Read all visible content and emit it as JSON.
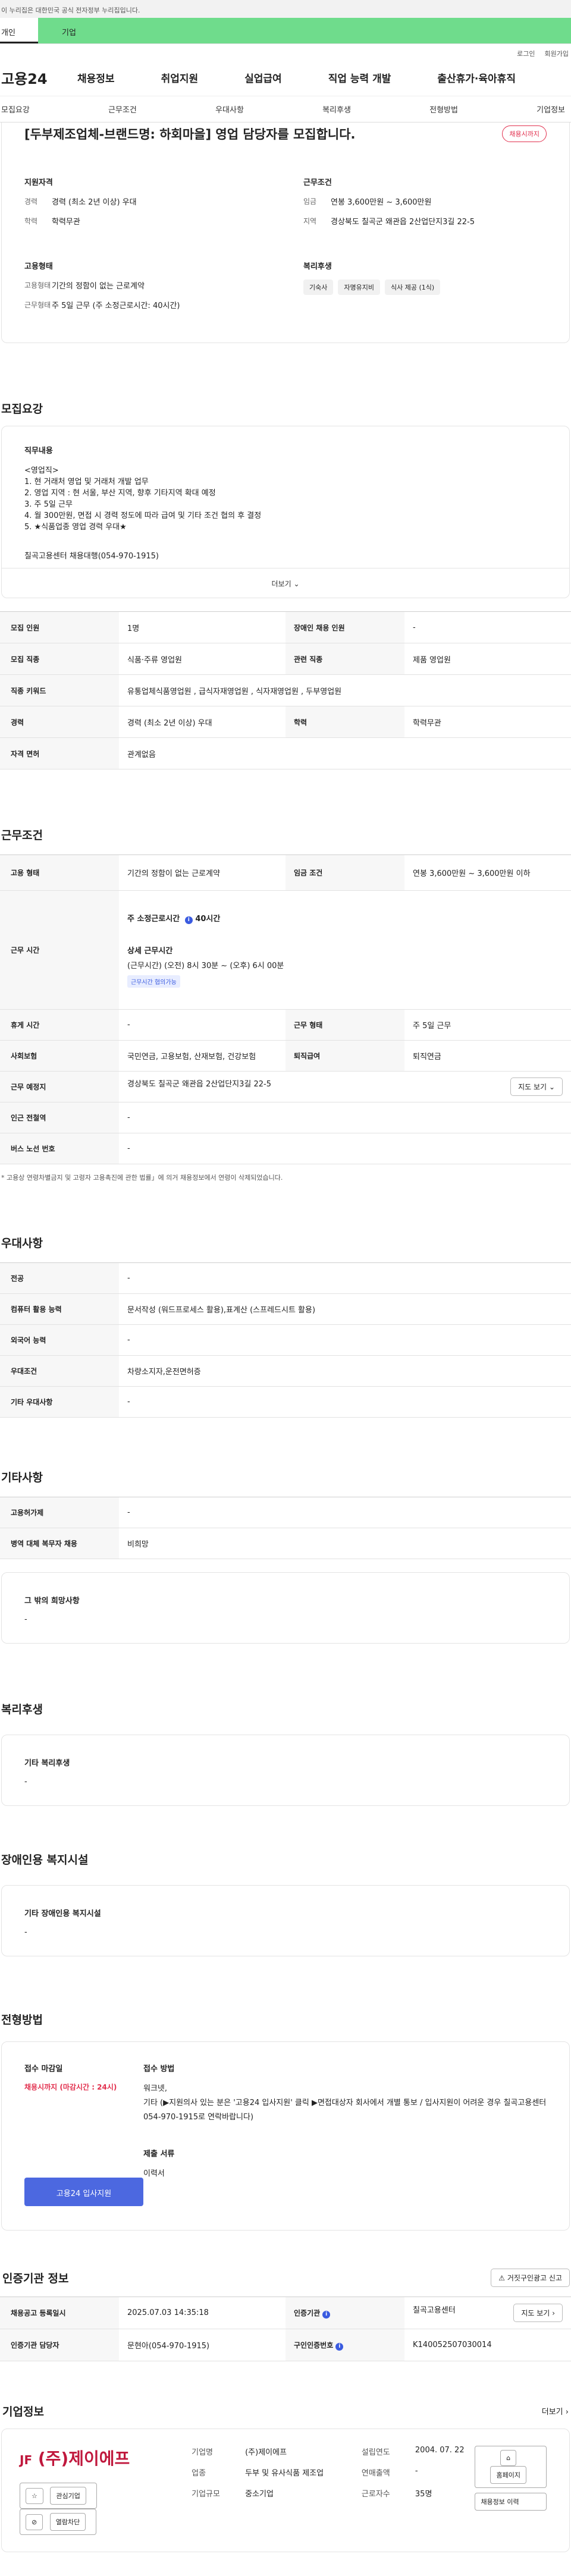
{
  "gov_banner": "이 누리집은 대한민국 공식 전자정부 누리집입니다.",
  "user_tabs": [
    "개인",
    "기업"
  ],
  "login_links": [
    "로그인",
    "회원가입"
  ],
  "logo": "고용24",
  "gnb": [
    "채용정보",
    "취업지원",
    "실업급여",
    "직업 능력 개발",
    "출산휴가·육아휴직"
  ],
  "subnav": [
    "모집요강",
    "근무조건",
    "우대사항",
    "복리후생",
    "전형방법",
    "기업정보"
  ],
  "job_title": "[두부제조업체-브랜드명: 하회마을] 영업 담당자를 모집합니다.",
  "status_badge": "채용시까지",
  "summary": {
    "support": {
      "title": "지원자격",
      "rows": [
        {
          "k": "경력",
          "v": "경력 (최소 2년 이상) 우대"
        },
        {
          "k": "학력",
          "v": "학력무관"
        }
      ]
    },
    "work": {
      "title": "근무조건",
      "rows": [
        {
          "k": "임금",
          "v": "연봉 3,600만원 ~ 3,600만원"
        },
        {
          "k": "지역",
          "v": "경상북도 칠곡군 왜관읍 2산업단지3길 22-5"
        }
      ]
    },
    "emp": {
      "title": "고용형태",
      "rows": [
        {
          "k": "고용형태",
          "v": "기간의 정함이 없는 근로계약"
        },
        {
          "k": "근무형태",
          "v": "주 5일 근무 (주 소정근로시간: 40시간)"
        }
      ]
    },
    "welfare": {
      "title": "복리후생",
      "tags": [
        "기숙사",
        "자명유지비",
        "식사 제공 (1식)"
      ]
    }
  },
  "recruit": {
    "section": "모집요강",
    "desc_title": "직무내용",
    "desc": "<영업직>\n1. 현 거래처 영업 및 거래처 개발 업무\n2. 영업 지역 : 현 서울, 부산 지역, 향후 기타지역 확대 예정\n3. 주 5일 근무\n4. 월 300만원, 면접 시 경력 정도에 따라 급여 및 기타 조건 협의 후 결정\n5. ★식품업종 영업 경력 우대★",
    "contact": "칠곡고용센터 채용대행(054-970-1915)",
    "more": "더보기",
    "rows": [
      {
        "k": "모집 인원",
        "v": "1명",
        "k2": "장애인 채용 인원",
        "v2": "-"
      },
      {
        "k": "모집 직종",
        "v": "식품·주류 영업원",
        "k2": "관련 직종",
        "v2": "제품 영업원"
      },
      {
        "k": "직종 키워드",
        "v": "유통업체식품영업원 , 급식자재영업원 , 식자재영업원 , 두부영업원"
      },
      {
        "k": "경력",
        "v": "경력 (최소 2년 이상) 우대",
        "k2": "학력",
        "v2": "학력무관"
      },
      {
        "k": "자격 면허",
        "v": "관계없음"
      }
    ]
  },
  "conditions": {
    "section": "근무조건",
    "emp_k": "고용 형태",
    "emp_v": "기간의 정함이 없는 근로계약",
    "wage_k": "임금 조건",
    "wage_v": "연봉 3,600만원 ~ 3,600만원 이하",
    "time_k": "근무 시간",
    "time_weekly": "주 소정근로시간",
    "time_weekly_v": "40시간",
    "time_detail_t": "상세 근무시간",
    "time_detail": "(근무시간) (오전) 8시 30분 ~ (오후) 6시 00분",
    "time_badge": "근무시간 협의가능",
    "rest_k": "휴게 시간",
    "rest_v": "-",
    "form_k": "근무 형태",
    "form_v": "주 5일 근무",
    "ins_k": "사회보험",
    "ins_v": "국민연금, 고용보험, 산재보험, 건강보험",
    "ret_k": "퇴직급여",
    "ret_v": "퇴직연금",
    "loc_k": "근무 예정지",
    "loc_v": "경상북도 칠곡군 왜관읍 2산업단지3길 22-5",
    "map_btn": "지도 보기",
    "sub_k": "인근 전철역",
    "sub_v": "-",
    "bus_k": "버스 노선 번호",
    "bus_v": "-",
    "note": "* 고용상 연령차별금지 및 고령자 고용촉진에 관한 법률」에 의거 채용정보에서 연령이 삭제되었습니다."
  },
  "pref": {
    "section": "우대사항",
    "rows": [
      {
        "k": "전공",
        "v": "-"
      },
      {
        "k": "컴퓨터 활용 능력",
        "v": "문서작성 (워드프로세스 활용),표계산 (스프레드시트 활용)"
      },
      {
        "k": "외국어 능력",
        "v": "-"
      },
      {
        "k": "우대조건",
        "v": "차량소지자,운전면허증"
      },
      {
        "k": "기타 우대사항",
        "v": "-"
      }
    ]
  },
  "etc": {
    "section": "기타사항",
    "rows": [
      {
        "k": "고용허가제",
        "v": "-"
      },
      {
        "k": "병역 대체 복무자 채용",
        "v": "비희망"
      }
    ],
    "box_t": "그 밖의 희망사항",
    "box_v": "-"
  },
  "welfare_sec": {
    "section": "복리후생",
    "box_t": "기타 복리후생",
    "box_v": "-"
  },
  "disabled_sec": {
    "section": "장애인용 복지시설",
    "box_t": "기타 장애인용 복지시설",
    "box_v": "-"
  },
  "process": {
    "section": "전형방법",
    "deadline_t": "접수 마감일",
    "deadline_v": "채용시까지 (마감시간 : 24시)",
    "apply_btn": "고용24 입사지원",
    "method_t": "접수 방법",
    "method_v": "워크넷,\n기타 (▶지원의사 있는 분은 '고용24 입사지원' 클릭 ▶면접대상자 회사에서 개별 통보 / 입사지원이 어려운 경우 칠곡고용센터 054-970-1915로 연락바랍니다)",
    "docs_t": "제출 서류",
    "docs_v": "이력서"
  },
  "cert": {
    "section": "인증기관 정보",
    "report_btn": "거짓구인광고 신고",
    "reg_k": "채용공고 등록일시",
    "reg_v": "2025.07.03 14:35:18",
    "org_k": "인증기관",
    "org_v": "칠곡고용센터",
    "map_btn": "지도 보기",
    "mgr_k": "인증기관 담당자",
    "mgr_v": "문현아(054-970-1915)",
    "no_k": "구인인증번호",
    "no_v": "K140052507030014"
  },
  "company": {
    "section": "기업정보",
    "more": "더보기",
    "name": "(주)제이에프",
    "logo_mark": "JF",
    "btn_like": "관심기업",
    "btn_block": "열람차단",
    "btn_home": "홈페이지",
    "btn_jobs": "채용정보 이력",
    "rows": [
      {
        "k": "기업명",
        "v": "(주)제이에프"
      },
      {
        "k": "업종",
        "v": "두부 및 유사식품 제조업"
      },
      {
        "k": "기업규모",
        "v": "중소기업"
      }
    ],
    "rows2": [
      {
        "k": "설립연도",
        "v": "2004. 07. 22"
      },
      {
        "k": "연매출액",
        "v": "-"
      },
      {
        "k": "근로자수",
        "v": "35명"
      }
    ]
  }
}
